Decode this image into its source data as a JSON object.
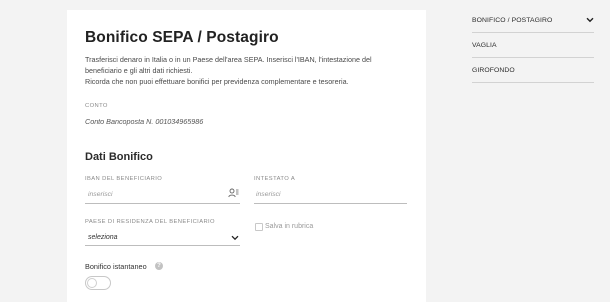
{
  "page": {
    "title": "Bonifico SEPA / Postagiro",
    "intro_line1": "Trasferisci denaro in Italia o in un Paese dell'area SEPA. Inserisci l'IBAN, l'intestazione del",
    "intro_line2": "beneficiario e gli altri dati richiesti.",
    "intro_line3": "Ricorda che non puoi effettuare bonifici per previdenza complementare e tesoreria."
  },
  "account": {
    "label": "CONTO",
    "value": "Conto Bancoposta N. 001034965986"
  },
  "form": {
    "section_title": "Dati Bonifico",
    "iban": {
      "label": "IBAN DEL BENEFICIARIO",
      "placeholder": "inserisci",
      "icon": "address-book-icon"
    },
    "holder": {
      "label": "INTESTATO A",
      "placeholder": "inserisci"
    },
    "country": {
      "label": "PAESE DI RESIDENZA DEL BENEFICIARIO",
      "value": "seleziona",
      "icon": "chevron-down-icon"
    },
    "save_contact": {
      "label": "Salva in rubrica",
      "checked": false
    },
    "instant": {
      "label": "Bonifico istantaneo",
      "info_icon": "info-icon",
      "on": false
    }
  },
  "sidebar": {
    "items": [
      {
        "label": "BONIFICO / POSTAGIRO",
        "expanded": true
      },
      {
        "label": "VAGLIA"
      },
      {
        "label": "GIROFONDO"
      }
    ]
  },
  "colors": {
    "background": "#f3f3f3",
    "card": "#ffffff",
    "divider": "#d2d2d2"
  }
}
